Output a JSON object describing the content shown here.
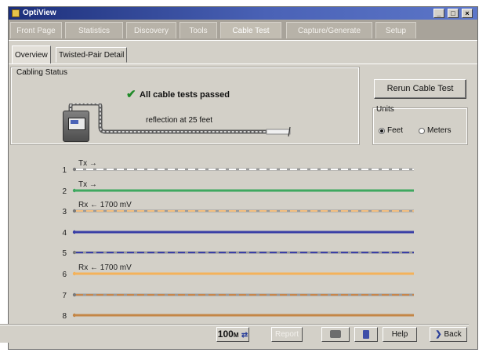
{
  "window": {
    "title": "OptiView",
    "controls": {
      "minimize": "_",
      "maximize": "□",
      "close": "×"
    }
  },
  "main_tabs": [
    {
      "label": "Front Page",
      "active": false
    },
    {
      "label": "Statistics",
      "active": false
    },
    {
      "label": "Discovery",
      "active": false
    },
    {
      "label": "Tools",
      "active": false
    },
    {
      "label": "Cable Test",
      "active": true
    },
    {
      "label": "Capture/Generate",
      "active": false
    },
    {
      "label": "Setup",
      "active": false
    }
  ],
  "sub_tabs": [
    {
      "label": "Overview",
      "active": true
    },
    {
      "label": "Twisted-Pair Detail",
      "active": false
    }
  ],
  "cabling_status": {
    "label": "Cabling Status",
    "check_icon": "✔",
    "message": "All cable tests passed",
    "reflection": "reflection at 25 feet"
  },
  "rerun_label": "Rerun Cable Test",
  "units": {
    "label": "Units",
    "options": [
      {
        "label": "Feet",
        "selected": true
      },
      {
        "label": "Meters",
        "selected": false
      }
    ]
  },
  "pairs": [
    {
      "num": "1",
      "color": "#ffffff",
      "dashed": true,
      "annotation": "Tx",
      "arrow": "→"
    },
    {
      "num": "2",
      "color": "#3fa860",
      "dashed": false,
      "annotation": "Tx",
      "arrow": "→"
    },
    {
      "num": "3",
      "color": "#f3bf80",
      "dashed": true,
      "annotation": "Rx",
      "arrow": "←",
      "value": "1700 mV"
    },
    {
      "num": "4",
      "color": "#3a3fa6",
      "dashed": false,
      "annotation": "",
      "arrow": ""
    },
    {
      "num": "5",
      "color": "#3a3fa6",
      "dashed": true,
      "annotation": "",
      "arrow": ""
    },
    {
      "num": "6",
      "color": "#f4b25a",
      "dashed": false,
      "annotation": "Rx",
      "arrow": "←",
      "value": "1700 mV"
    },
    {
      "num": "7",
      "color": "#c9864a",
      "dashed": true,
      "annotation": "",
      "arrow": ""
    },
    {
      "num": "8",
      "color": "#c48646",
      "dashed": false,
      "annotation": "",
      "arrow": ""
    }
  ],
  "status_bar": {
    "speed": "100",
    "speed_unit": "M",
    "speed_icon": "⇄",
    "report": "Report",
    "print_icon": "printer-icon",
    "trash_icon": "trash-icon",
    "help": "Help",
    "back_icon": "❯",
    "back": "Back"
  }
}
